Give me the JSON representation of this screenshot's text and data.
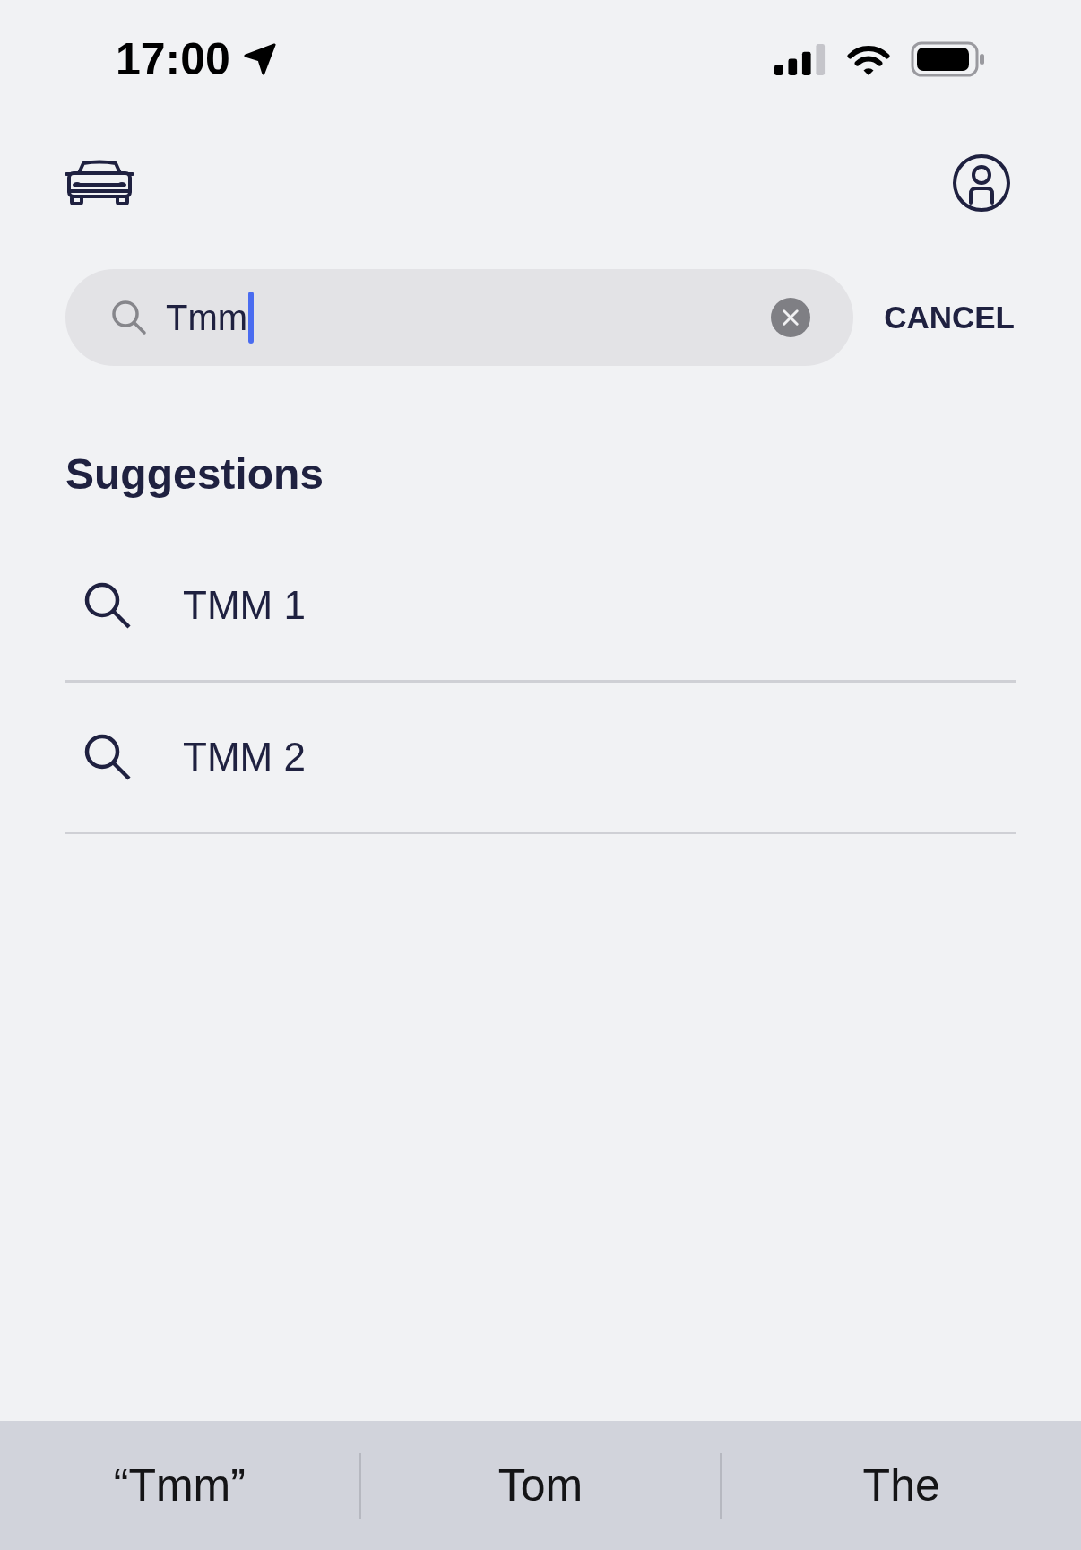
{
  "status_bar": {
    "time": "17:00"
  },
  "search": {
    "value": "Tmm",
    "focused": true,
    "cancel_label": "CANCEL"
  },
  "suggestions": {
    "title": "Suggestions",
    "items": [
      {
        "label": "TMM 1"
      },
      {
        "label": "TMM 2"
      }
    ]
  },
  "keyboard_suggestions": [
    {
      "label": "“Tmm”"
    },
    {
      "label": "Tom"
    },
    {
      "label": "The"
    }
  ]
}
